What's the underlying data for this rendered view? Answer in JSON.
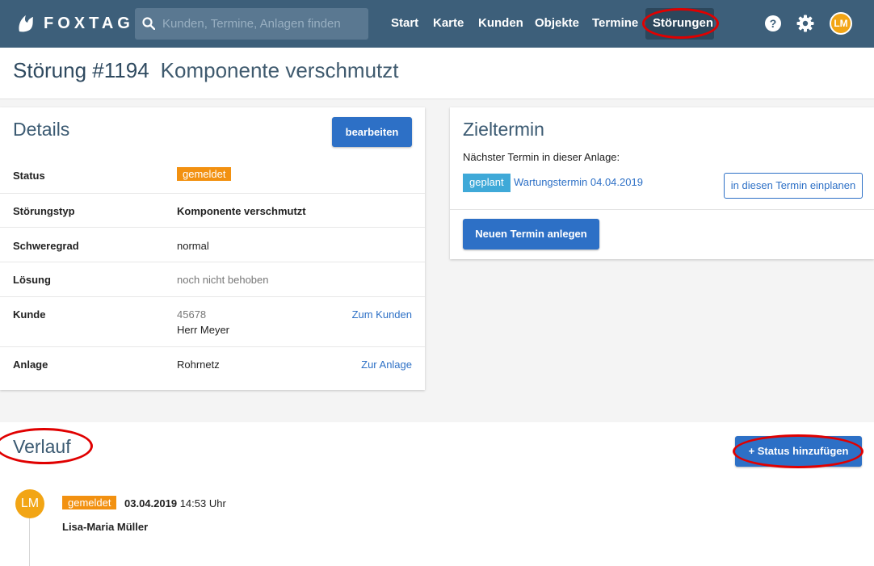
{
  "app": {
    "brand": "FOXTAG"
  },
  "search": {
    "placeholder": "Kunden, Termine, Anlagen finden"
  },
  "nav": {
    "items": [
      "Start",
      "Karte",
      "Kunden",
      "Objekte",
      "Termine",
      "Störungen"
    ],
    "active": "Störungen",
    "avatar_initials": "LM"
  },
  "page": {
    "number": "Störung #1194",
    "subtitle": "Komponente verschmutzt"
  },
  "details": {
    "title": "Details",
    "edit_label": "bearbeiten",
    "rows": [
      {
        "label": "Status",
        "value": "gemeldet"
      },
      {
        "label": "Störungstyp",
        "value": "Komponente verschmutzt"
      },
      {
        "label": "Schweregrad",
        "value": "normal"
      },
      {
        "label": "Lösung",
        "value": "noch nicht behoben"
      },
      {
        "label": "Kunde",
        "value": "45678",
        "value2": "Herr Meyer",
        "link": "Zum Kunden"
      },
      {
        "label": "Anlage",
        "value": "Rohrnetz",
        "link": "Zur Anlage"
      }
    ]
  },
  "zieltermin": {
    "title": "Zieltermin",
    "text": "Nächster Termin in dieser Anlage:",
    "badge": "geplant",
    "link": "Wartungstermin 04.04.2019",
    "schedule_label": "in diesen Termin einplanen",
    "new_label": "Neuen Termin anlegen"
  },
  "verlauf": {
    "title": "Verlauf",
    "add_label": "+ Status hinzufügen",
    "entries": [
      {
        "initials": "LM",
        "status": "gemeldet",
        "date": "03.04.2019",
        "time": "14:53 Uhr",
        "user": "Lisa-Maria Müller"
      }
    ]
  },
  "colors": {
    "nav": "#3d5f7a",
    "primary": "#2d70c6",
    "orange": "#f29111",
    "blue_badge": "#3fa9d8",
    "highlight": "#e00000"
  }
}
